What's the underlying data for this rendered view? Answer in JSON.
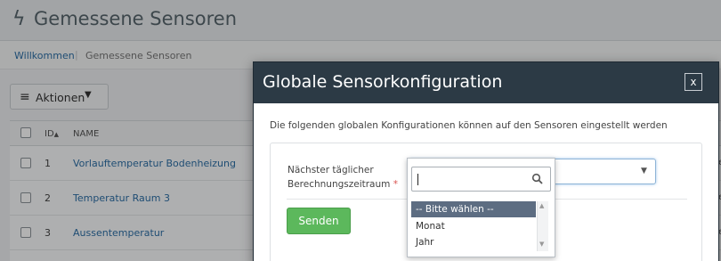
{
  "page": {
    "title": "Gemessene Sensoren",
    "title_icon": "bolt-icon",
    "breadcrumb": {
      "home": "Willkommen",
      "current": "Gemessene Sensoren"
    },
    "actions_label": "Aktionen",
    "table": {
      "headers": {
        "id": "ID",
        "name": "NAME"
      },
      "rows": [
        {
          "id": "1",
          "name": "Vorlauftemperatur Bodenheizung",
          "tail": "e"
        },
        {
          "id": "2",
          "name": "Temperatur Raum 3",
          "tail": "e"
        },
        {
          "id": "3",
          "name": "Aussentemperatur",
          "tail": "e"
        }
      ]
    }
  },
  "modal": {
    "title": "Globale Sensorkonfiguration",
    "close_label": "x",
    "description": "Die folgenden globalen Konfigurationen können auf den Sensoren eingestellt werden",
    "field_label": "Nächster täglicher Berechnungszeitraum",
    "required_mark": "*",
    "send_label": "Senden"
  },
  "dropdown": {
    "search_value": "",
    "options": [
      "-- Bitte wählen --",
      "Monat",
      "Jahr"
    ],
    "selected_index": 0
  },
  "colors": {
    "modal_header": "#2c3a45",
    "link": "#2d6fa6",
    "send_button": "#5cb85c",
    "selected_option": "#5d6d82",
    "required": "#d9534f"
  }
}
